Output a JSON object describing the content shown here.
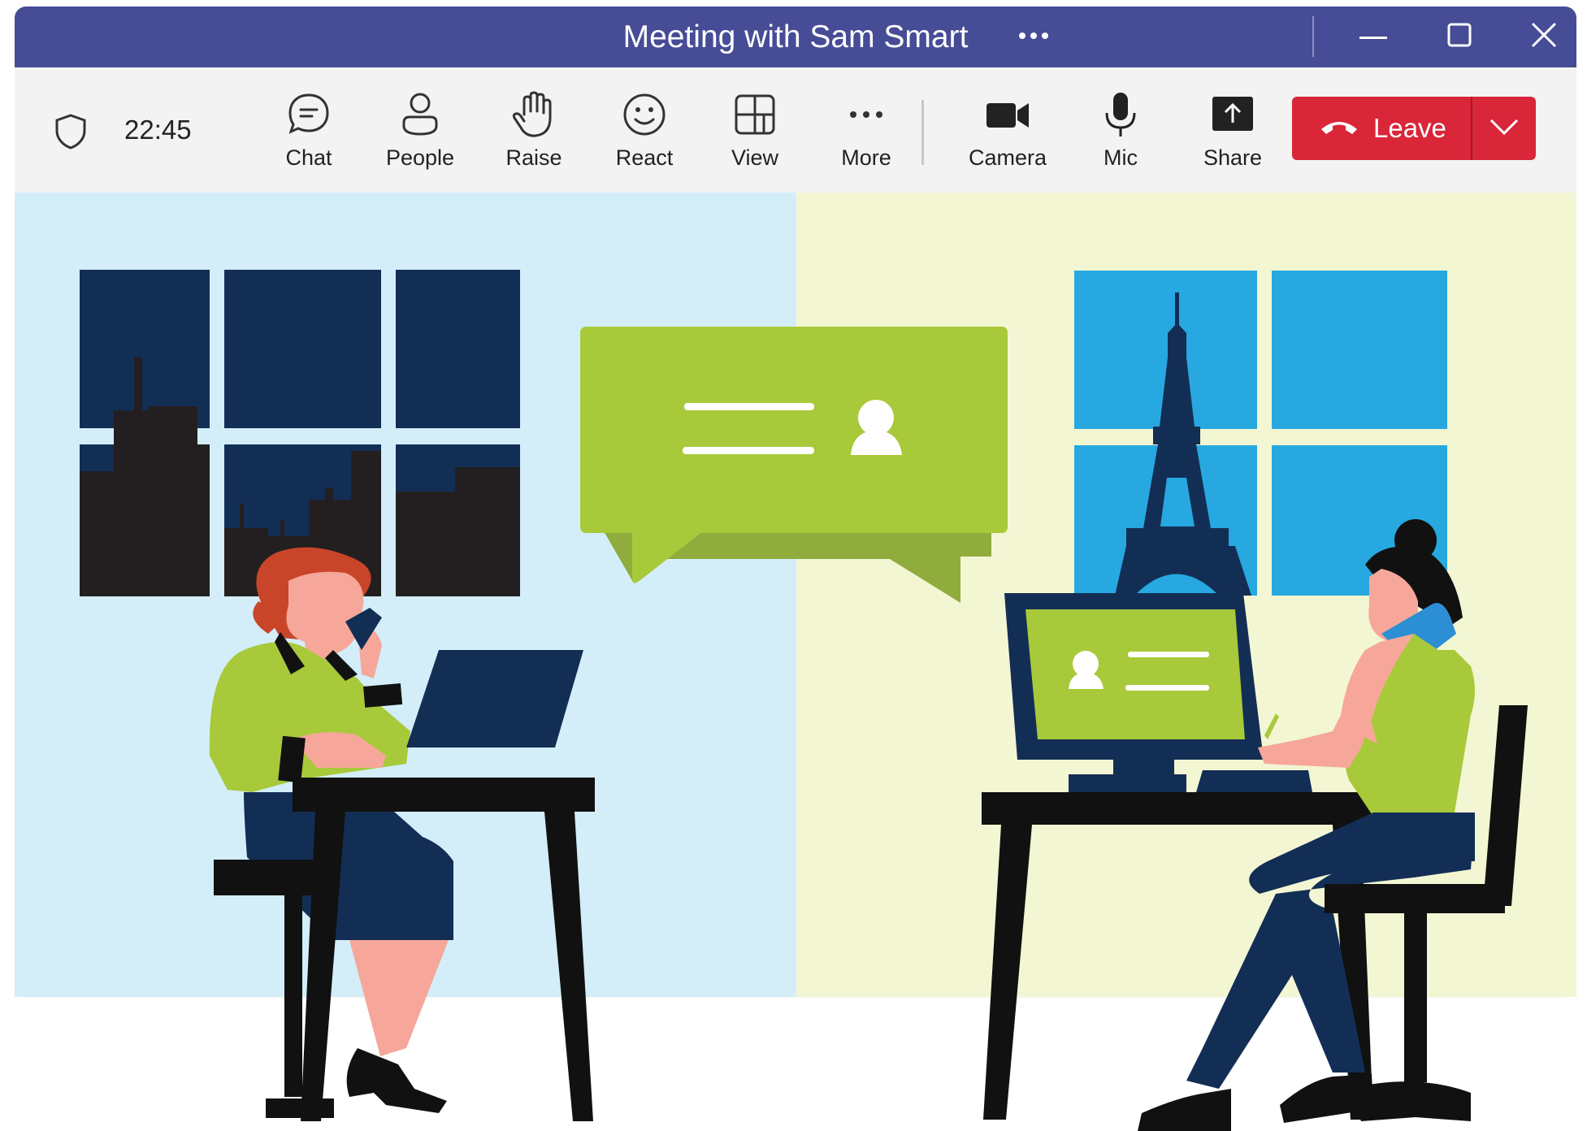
{
  "window": {
    "title": "Meeting with Sam Smart",
    "controls": [
      "more-options-icon",
      "minimize-icon",
      "maximize-icon",
      "close-icon"
    ]
  },
  "toolbar": {
    "timer": "22:45",
    "items": [
      {
        "label": "Chat",
        "icon": "chat-icon"
      },
      {
        "label": "People",
        "icon": "people-icon"
      },
      {
        "label": "Raise",
        "icon": "raise-hand-icon"
      },
      {
        "label": "React",
        "icon": "react-smiley-icon"
      },
      {
        "label": "View",
        "icon": "view-grid-icon"
      },
      {
        "label": "More",
        "icon": "more-icon"
      },
      {
        "label": "Camera",
        "icon": "camera-icon"
      },
      {
        "label": "Mic",
        "icon": "mic-icon"
      },
      {
        "label": "Share",
        "icon": "share-icon"
      }
    ],
    "leave": {
      "label": "Leave",
      "icon": "hang-up-icon"
    }
  },
  "colors": {
    "titlebar": "#464c95",
    "leave": "#d92638",
    "left_panel": "#d3eef9",
    "right_panel": "#f3f6d2",
    "accent_green": "#a8c93a",
    "navy": "#132e55",
    "sky": "#27a8e0"
  }
}
